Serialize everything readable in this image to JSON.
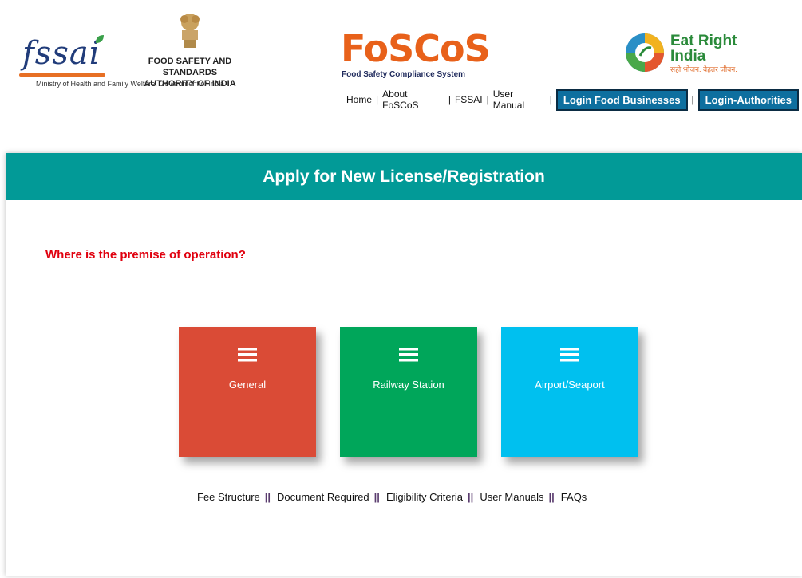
{
  "header": {
    "fssai_logo_text": "fssai",
    "org_name_line1": "FOOD SAFETY AND STANDARDS",
    "org_name_line2": "AUTHORITY OF INDIA",
    "ministry": "Ministry of Health and Family Welfare, Government of India",
    "foscos_logo": "FoSCoS",
    "foscos_tagline": "Food Safety Compliance System",
    "eat_right_line1": "Eat Right",
    "eat_right_line2": "India",
    "eat_right_tagline": "सही भोजन. बेहतर जीवन."
  },
  "nav": {
    "items": [
      "Home",
      "About FoSCoS",
      "FSSAI",
      "User Manual"
    ],
    "separator": "|",
    "login_food_businesses": "Login Food Businesses",
    "login_authorities": "Login-Authorities"
  },
  "panel": {
    "title": "Apply for New License/Registration",
    "question": "Where is the premise of operation?",
    "tiles": [
      {
        "label": "General",
        "color": "#da4b36",
        "icon": "menu-icon"
      },
      {
        "label": "Railway Station",
        "color": "#00a65a",
        "icon": "menu-icon"
      },
      {
        "label": "Airport/Seaport",
        "color": "#00c0ef",
        "icon": "menu-icon"
      }
    ],
    "footer_links": [
      "Fee Structure",
      "Document Required",
      "Eligibility Criteria",
      "User Manuals",
      "FAQs"
    ],
    "footer_separator": "||"
  },
  "colors": {
    "panel_header": "#029a97",
    "question_text": "#e0000e",
    "login_button": "#0e6f9f"
  }
}
